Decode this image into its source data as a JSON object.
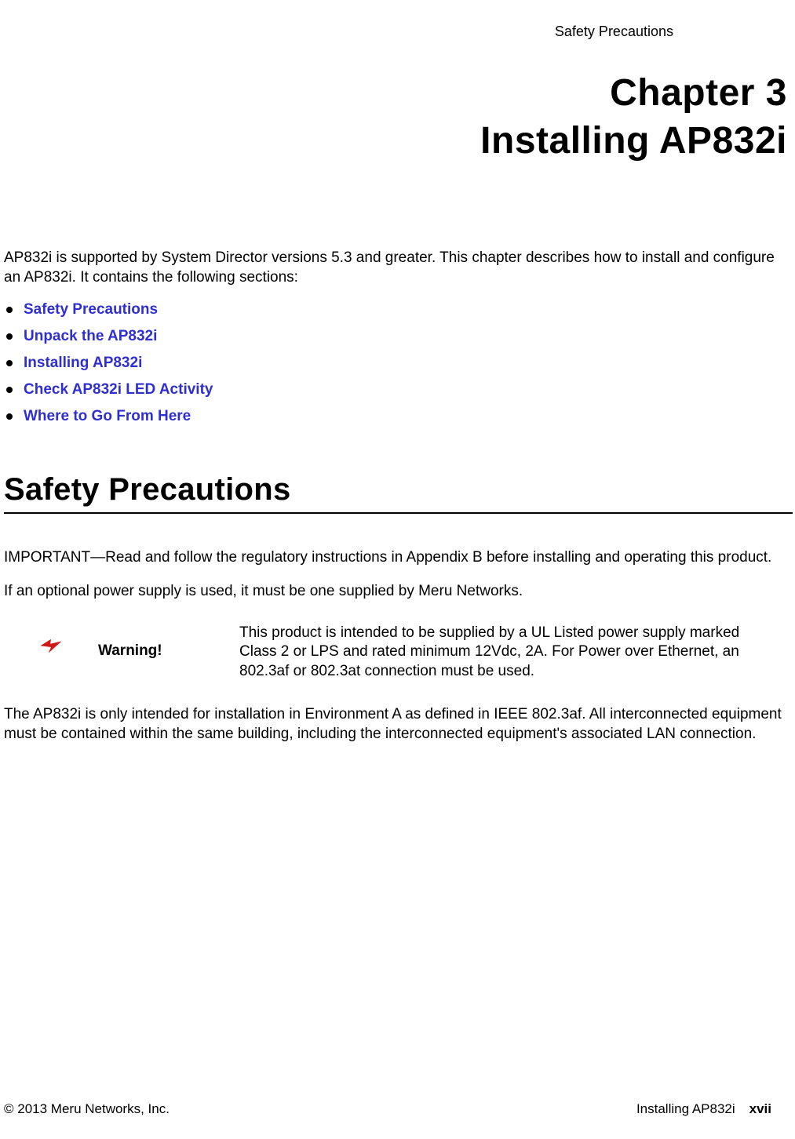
{
  "header": {
    "running": "Safety Precautions"
  },
  "chapter": {
    "num": "Chapter 3",
    "title": "Installing AP832i"
  },
  "intro": "AP832i is supported by System Director versions 5.3 and greater. This chapter describes how to install and configure an AP832i. It contains the following sections:",
  "toc": {
    "items": [
      {
        "label": "Safety Precautions"
      },
      {
        "label": "Unpack the AP832i"
      },
      {
        "label": "Installing AP832i"
      },
      {
        "label": "Check AP832i LED Activity"
      },
      {
        "label": "Where to Go From Here"
      }
    ]
  },
  "section": {
    "heading": "Safety Precautions",
    "p1": "IMPORTANT—Read and follow the regulatory instructions in Appendix B before installing and operating this product.",
    "p2": "If an optional power supply is used, it must be one supplied by Meru Networks.",
    "warning": {
      "label": "Warning!",
      "text": "This product is intended to be supplied by a UL Listed power supply marked Class 2 or LPS and rated minimum 12Vdc, 2A. For Power over Ethernet, an 802.3af or 802.3at connection must be used."
    },
    "p3": "The AP832i is only intended for installation in Environment A as defined in IEEE 802.3af. All interconnected equipment must be contained within the same building, including the interconnected equipment's associated LAN connection."
  },
  "footer": {
    "copyright": "© 2013 Meru Networks, Inc.",
    "doc": "Installing AP832i",
    "page": "xvii"
  },
  "colors": {
    "link": "#2f2fd0",
    "warning_icon": "#d01a1a"
  },
  "icons": {
    "bullet": "bullet-icon",
    "warning": "lightning-icon"
  }
}
